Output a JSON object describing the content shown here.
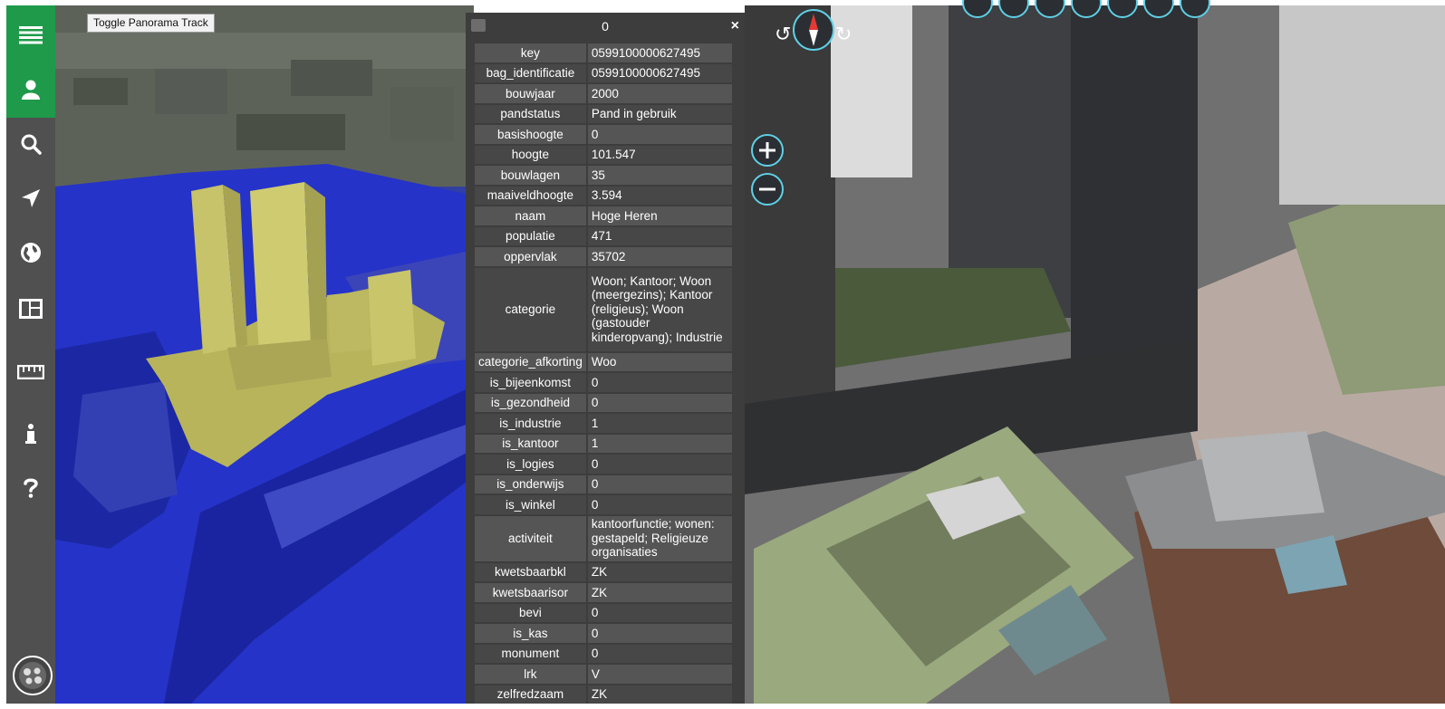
{
  "sidebar": {
    "items": [
      {
        "icon": "menu-icon"
      },
      {
        "icon": "user-icon"
      },
      {
        "icon": "search-icon"
      },
      {
        "icon": "navigate-icon"
      },
      {
        "icon": "globe-icon"
      },
      {
        "icon": "dashboard-icon"
      },
      {
        "icon": "ruler-icon"
      },
      {
        "icon": "info-icon"
      },
      {
        "icon": "help-icon"
      }
    ],
    "bottom_icon": "basemap-globe-icon",
    "colors": {
      "accent": "#1f9a4a",
      "background": "#505050"
    }
  },
  "map": {
    "panorama_toggle_label": "Toggle Panorama Track",
    "colors": {
      "selected_building": "#c9c56a",
      "buildings_overlay": "#2230c6"
    }
  },
  "attribute_panel": {
    "title": "0",
    "close_label": "×",
    "rows": [
      {
        "key": "key",
        "value": "0599100000627495"
      },
      {
        "key": "bag_identificatie",
        "value": "0599100000627495"
      },
      {
        "key": "bouwjaar",
        "value": "2000"
      },
      {
        "key": "pandstatus",
        "value": "Pand in gebruik"
      },
      {
        "key": "basishoogte",
        "value": "0"
      },
      {
        "key": "hoogte",
        "value": "101.547"
      },
      {
        "key": "bouwlagen",
        "value": "35"
      },
      {
        "key": "maaiveldhoogte",
        "value": "3.594"
      },
      {
        "key": "naam",
        "value": "Hoge Heren"
      },
      {
        "key": "populatie",
        "value": "471"
      },
      {
        "key": "oppervlak",
        "value": "35702"
      },
      {
        "key": "categorie",
        "value": "Woon; Kantoor; Woon (meergezins); Kantoor (religieus); Woon (gastouder kinderopvang); Industrie"
      },
      {
        "key": "categorie_afkorting",
        "value": "Woo"
      },
      {
        "key": "is_bijeenkomst",
        "value": "0"
      },
      {
        "key": "is_gezondheid",
        "value": "0"
      },
      {
        "key": "is_industrie",
        "value": "1"
      },
      {
        "key": "is_kantoor",
        "value": "1"
      },
      {
        "key": "is_logies",
        "value": "0"
      },
      {
        "key": "is_onderwijs",
        "value": "0"
      },
      {
        "key": "is_winkel",
        "value": "0"
      },
      {
        "key": "activiteit",
        "value": "kantoorfunctie; wonen: gestapeld; Religieuze organisaties"
      },
      {
        "key": "kwetsbaarbkl",
        "value": "ZK"
      },
      {
        "key": "kwetsbaarisor",
        "value": "ZK"
      },
      {
        "key": "bevi",
        "value": "0"
      },
      {
        "key": "is_kas",
        "value": "0"
      },
      {
        "key": "monument",
        "value": "0"
      },
      {
        "key": "lrk",
        "value": "V"
      },
      {
        "key": "zelfredzaam",
        "value": "ZK"
      }
    ]
  },
  "aerial_controls": {
    "zoom_in_label": "+",
    "zoom_out_label": "−",
    "compass_icon": "compass-icon",
    "rotate_left_icon": "rotate-left-icon",
    "rotate_right_icon": "rotate-right-icon",
    "top_tools": [
      "tool-icon-1",
      "tool-icon-2",
      "tool-icon-3",
      "tool-icon-4",
      "tool-icon-5",
      "tool-icon-6",
      "tool-icon-7"
    ]
  }
}
